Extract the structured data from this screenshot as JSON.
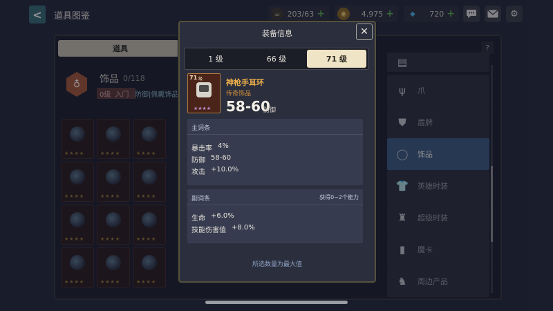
{
  "header": {
    "back_label": "<",
    "title": "道具图鉴",
    "resources": [
      {
        "icon": "stamina-cup-icon",
        "value": "203/63",
        "plus": "+"
      },
      {
        "icon": "gold-coin-icon",
        "value": "4,975",
        "plus": "+"
      },
      {
        "icon": "diamond-gem-icon",
        "value": "720",
        "plus": "+"
      }
    ],
    "icons": [
      "chat-bubble-icon",
      "mail-envelope-icon",
      "settings-gear-icon"
    ]
  },
  "background": {
    "tab_label": "道具",
    "help_label": "?",
    "category": {
      "title": "饰品",
      "count": "0/118",
      "level": "0级",
      "level_label": "入门",
      "desc": "防御|佩戴饰品能"
    },
    "grid_stars": "★★★★"
  },
  "sidebar": {
    "items": [
      {
        "icon": "scroll-icon",
        "label": ""
      },
      {
        "icon": "claw-icon",
        "label": "爪"
      },
      {
        "icon": "shield-icon",
        "label": "盾牌"
      },
      {
        "icon": "ring-icon",
        "label": "饰品",
        "active": true
      },
      {
        "icon": "clothes-icon",
        "label": "英雄时装"
      },
      {
        "icon": "suit-icon",
        "label": "超级时装"
      },
      {
        "icon": "card-icon",
        "label": "魔卡"
      },
      {
        "icon": "figure-icon",
        "label": "周边产品"
      }
    ]
  },
  "modal": {
    "title": "装备信息",
    "close_label": "✕",
    "level_tabs": [
      {
        "label": "1 级",
        "active": false
      },
      {
        "label": "66 级",
        "active": false
      },
      {
        "label": "71 级",
        "active": true
      }
    ],
    "item": {
      "level_badge": "71",
      "level_unit": "级",
      "stars": "★★★★",
      "name": "神枪手耳环",
      "rarity": "传奇饰品",
      "stat_value": "58-60",
      "stat_label": "防御"
    },
    "main_stats": {
      "title": "主词条",
      "rows": [
        {
          "label": "暴击率",
          "value": "4%"
        },
        {
          "label": "防御",
          "value": "58-60"
        },
        {
          "label": "攻击",
          "value": "+10.0%"
        }
      ]
    },
    "sub_stats": {
      "title": "副词条",
      "note": "获得0~2个能力",
      "rows": [
        {
          "label": "生命",
          "value": "+6.0%"
        },
        {
          "label": "技能伤害值",
          "value": "+8.0%"
        }
      ]
    },
    "footnote": "所选数量为最大值"
  }
}
